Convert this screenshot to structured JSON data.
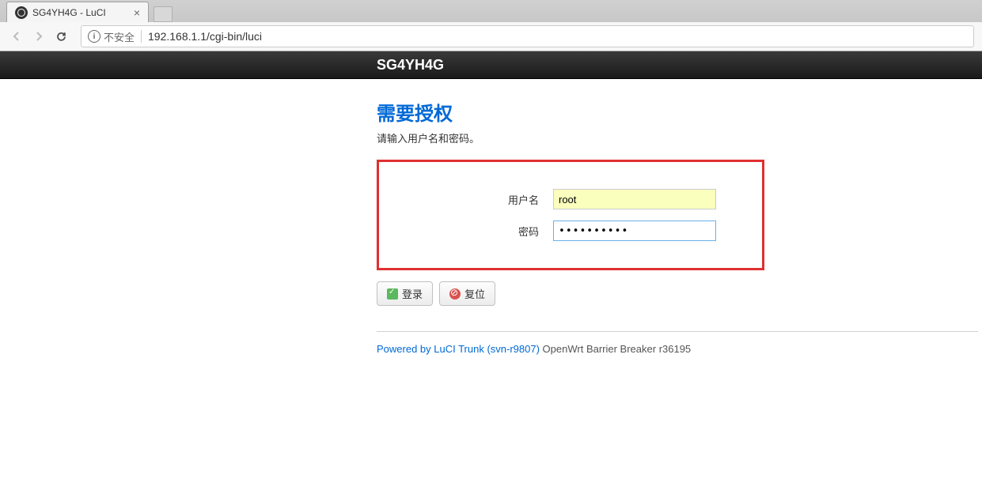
{
  "browser": {
    "tab_title": "SG4YH4G - LuCI",
    "security_label": "不安全",
    "url": "192.168.1.1/cgi-bin/luci"
  },
  "header": {
    "title": "SG4YH4G"
  },
  "auth": {
    "heading": "需要授权",
    "subtext": "请输入用户名和密码。",
    "username_label": "用户名",
    "username_value": "root",
    "password_label": "密码",
    "password_value": "••••••••••"
  },
  "buttons": {
    "login": "登录",
    "reset": "复位"
  },
  "footer": {
    "link_text": "Powered by LuCI Trunk (svn-r9807)",
    "version_text": " OpenWrt Barrier Breaker r36195"
  }
}
